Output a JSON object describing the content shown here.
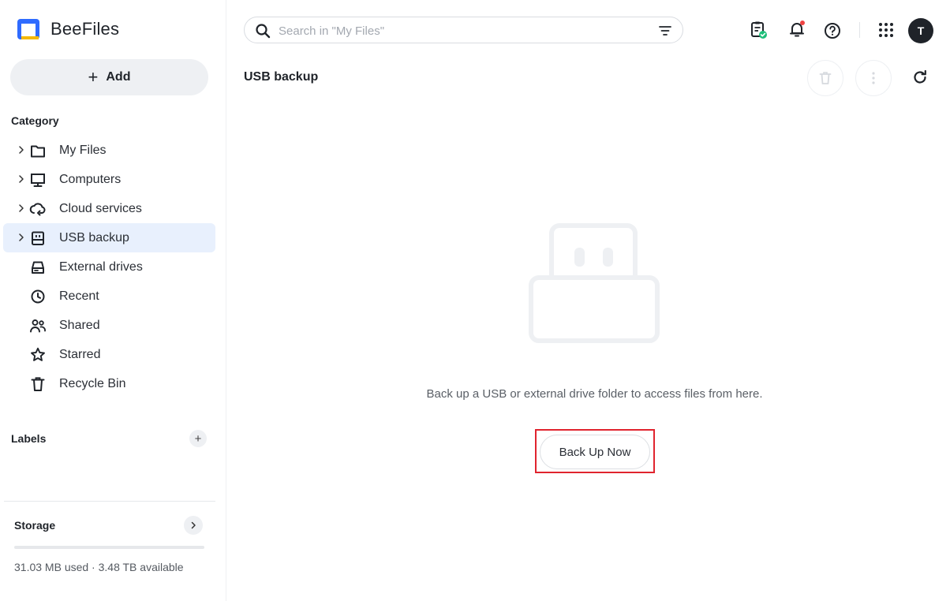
{
  "brand": {
    "name": "BeeFiles"
  },
  "sidebar": {
    "add_label": "Add",
    "category_title": "Category",
    "items": [
      {
        "label": "My Files",
        "icon": "folder-icon",
        "expandable": true,
        "active": false
      },
      {
        "label": "Computers",
        "icon": "monitor-icon",
        "expandable": true,
        "active": false
      },
      {
        "label": "Cloud services",
        "icon": "cloud-sync-icon",
        "expandable": true,
        "active": false
      },
      {
        "label": "USB backup",
        "icon": "usb-icon",
        "expandable": true,
        "active": true
      },
      {
        "label": "External drives",
        "icon": "hard-drive-icon",
        "expandable": false,
        "active": false
      },
      {
        "label": "Recent",
        "icon": "clock-icon",
        "expandable": false,
        "active": false
      },
      {
        "label": "Shared",
        "icon": "people-icon",
        "expandable": false,
        "active": false
      },
      {
        "label": "Starred",
        "icon": "star-icon",
        "expandable": false,
        "active": false
      },
      {
        "label": "Recycle Bin",
        "icon": "trash-icon",
        "expandable": false,
        "active": false
      }
    ],
    "labels_title": "Labels",
    "storage": {
      "title": "Storage",
      "usage_text": "31.03 MB used · 3.48 TB available",
      "used_fraction": 0.0
    }
  },
  "search": {
    "placeholder": "Search in \"My Files\""
  },
  "topbar": {
    "icons": [
      "task-list-icon",
      "notification-bell-icon",
      "help-icon",
      "apps-grid-icon"
    ],
    "avatar_initial": "T"
  },
  "main": {
    "title": "USB backup",
    "empty_message": "Back up a USB or external drive folder to access files from here.",
    "backup_button": "Back Up Now"
  },
  "colors": {
    "accent": "#2f6bff",
    "active_bg": "#e8f0fd",
    "highlight_frame": "#e0242e",
    "logo_yellow": "#f5b800"
  }
}
